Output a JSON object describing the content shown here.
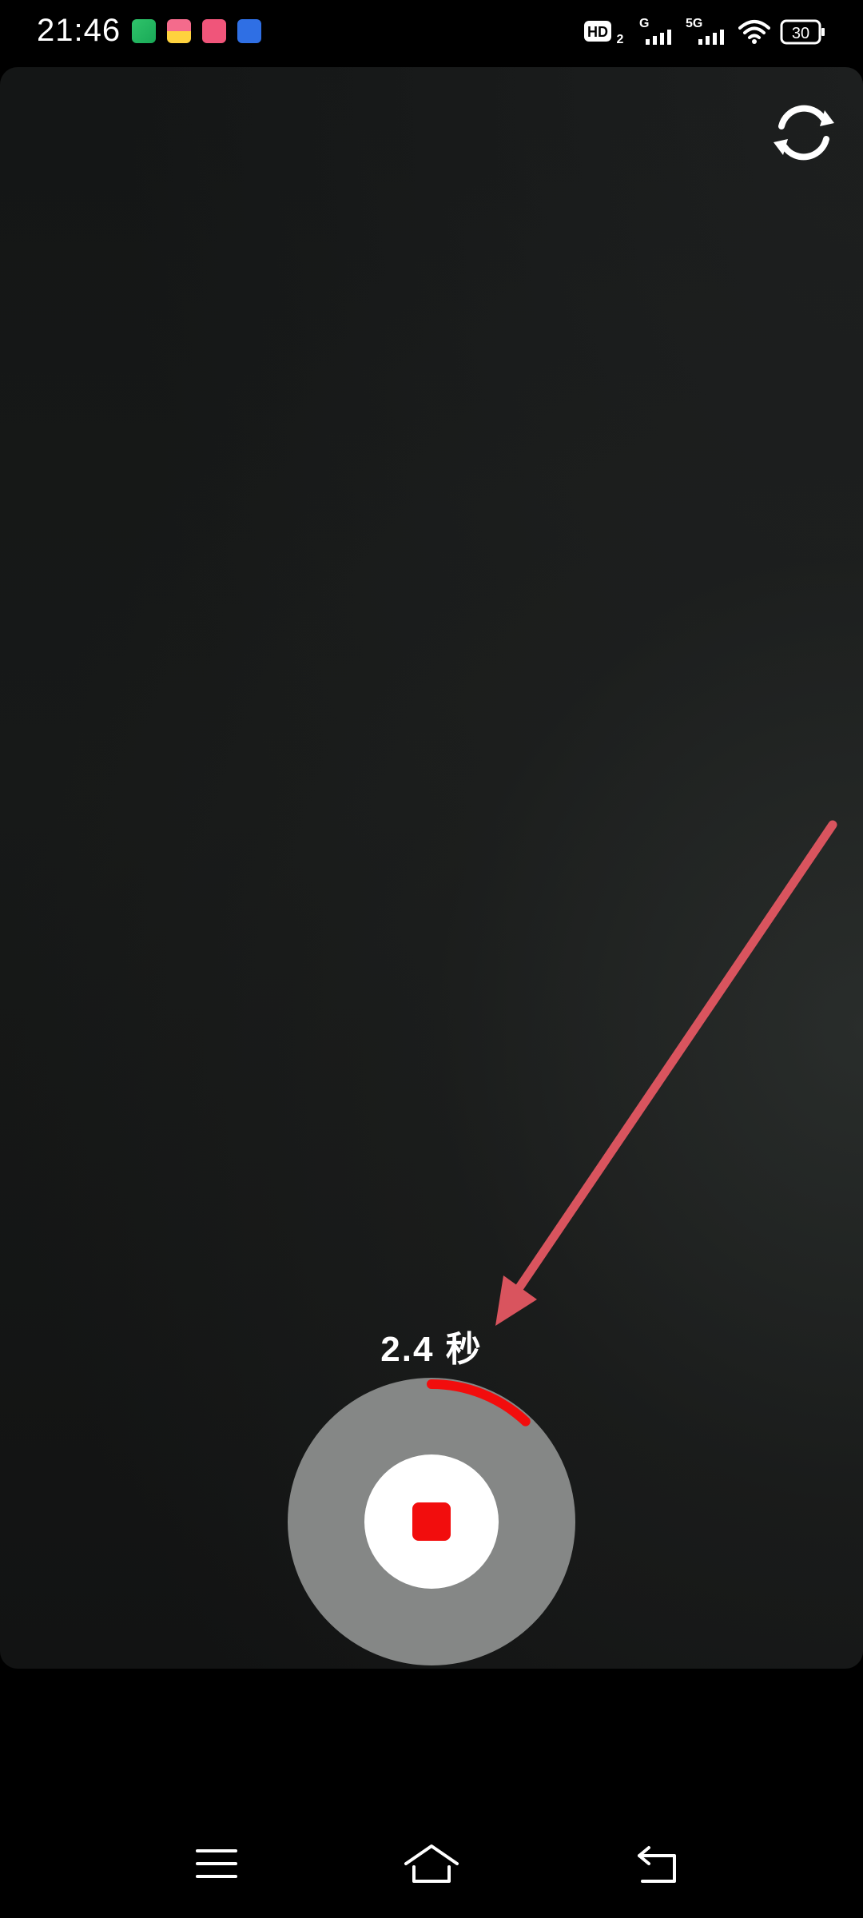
{
  "status_bar": {
    "time": "21:46",
    "notification_icons": [
      "iqiyi-app-icon",
      "gift-app-icon",
      "face-app-icon",
      "clock-app-icon"
    ],
    "hd_label": "HD",
    "hd_sub": "2",
    "network_1": "G",
    "network_2": "5G",
    "battery": "30"
  },
  "camera": {
    "flip_icon": "switch-camera-icon"
  },
  "recording": {
    "elapsed": "2.4 秒",
    "progress": 0.12,
    "colors": {
      "progress": "#f20d0d",
      "ring": "#858786",
      "stop": "#f20d0d"
    }
  },
  "annotation": {
    "color": "#d9545e"
  },
  "nav_bar": {
    "menu_icon": "menu-icon",
    "home_icon": "home-icon",
    "back_icon": "back-icon"
  }
}
